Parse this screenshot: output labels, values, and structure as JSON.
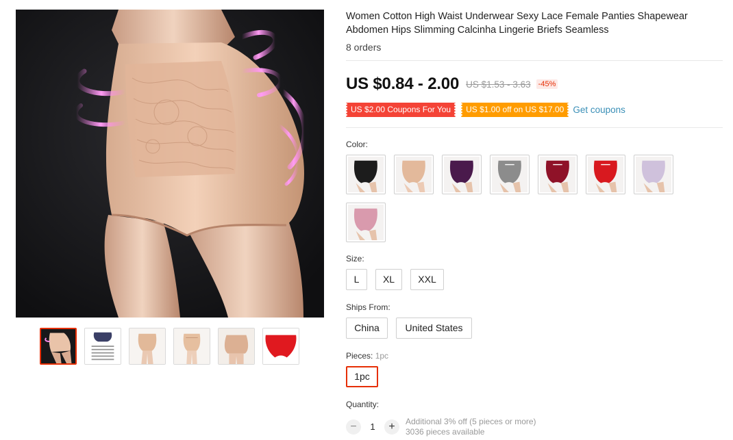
{
  "product": {
    "title": "Women Cotton High Waist Underwear Sexy Lace Female Panties Shapewear Abdomen Hips Slimming Calcinha Lingerie Briefs Seamless",
    "orders": "8 orders"
  },
  "pricing": {
    "price": "US $0.84 - 2.00",
    "original_price": "US $1.53 - 3.63",
    "discount": "-45%"
  },
  "coupons": {
    "items": [
      {
        "label": "US $2.00 Coupons For You",
        "color": "#f44336"
      },
      {
        "label": "US $1.00 off on US $17.00",
        "color": "#ff9c00"
      }
    ],
    "get_label": "Get coupons"
  },
  "gallery": {
    "thumbnails": [
      {
        "icon": "shapewear-nude-thumb",
        "active": true
      },
      {
        "icon": "size-chart-thumb",
        "active": false
      },
      {
        "icon": "shapewear-front-thumb",
        "active": false
      },
      {
        "icon": "shapewear-front-thumb",
        "active": false
      },
      {
        "icon": "shapewear-back-thumb",
        "active": false
      },
      {
        "icon": "red-briefs-thumb",
        "active": false
      }
    ]
  },
  "color": {
    "label": "Color:",
    "swatches": [
      {
        "name": "black",
        "hex": "#1c1c1c"
      },
      {
        "name": "nude",
        "hex": "#e3b99b"
      },
      {
        "name": "purple",
        "hex": "#4a1a4c"
      },
      {
        "name": "gray",
        "hex": "#8c8c8c"
      },
      {
        "name": "wine",
        "hex": "#8f1228"
      },
      {
        "name": "red",
        "hex": "#d8191f"
      },
      {
        "name": "lavender",
        "hex": "#cfc1dc"
      },
      {
        "name": "pink",
        "hex": "#d99aad"
      }
    ]
  },
  "size": {
    "label": "Size:",
    "options": [
      "L",
      "XL",
      "XXL"
    ]
  },
  "ships_from": {
    "label": "Ships From:",
    "options": [
      "China",
      "United States"
    ]
  },
  "pieces": {
    "label": "Pieces:",
    "selected_value": "1pc",
    "options": [
      "1pc"
    ]
  },
  "quantity": {
    "label": "Quantity:",
    "value": "1",
    "minus": "−",
    "plus": "+",
    "note_discount": "Additional 3% off (5 pieces or more)",
    "note_available": "3036 pieces available"
  },
  "theme": {
    "accent": "#e62e04",
    "link": "#3a8fb7"
  }
}
